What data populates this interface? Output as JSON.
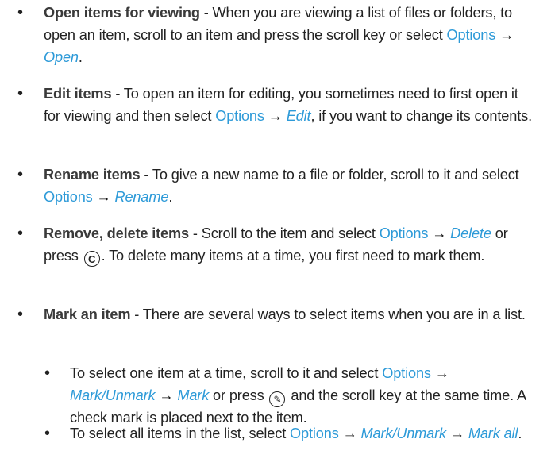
{
  "items": [
    {
      "term": "Open items for viewing",
      "text1": " - When you are viewing a list of files or folders, to open an item, scroll to an item and press the scroll key or select ",
      "menu": "Options",
      "arrow": " → ",
      "opt": "Open",
      "end": "."
    },
    {
      "term": "Edit items",
      "text1": " - To open an item for editing, you sometimes need to first open it for viewing and then select ",
      "menu": "Options",
      "arrow": " → ",
      "opt": "Edit",
      "end": ", if you want to change its contents."
    },
    {
      "term": "Rename items",
      "text1": " - To give a new name to a file or folder, scroll to it and select ",
      "menu": "Options",
      "arrow": " → ",
      "opt": "Rename",
      "end": "."
    },
    {
      "term": "Remove, delete items",
      "text1": " - Scroll to the item and select ",
      "menu": "Options",
      "arrow": " → ",
      "opt": "Delete",
      "text2": " or press ",
      "key": "C",
      "end": ". To delete many items at a time, you first need to mark them."
    },
    {
      "term": "Mark an item",
      "text1": " - There are several ways to select items when you are in a list."
    }
  ],
  "subitems": [
    {
      "text1": "To select one item at a time, scroll to it and select ",
      "menu": "Options",
      "arrow1": " → ",
      "opt1": "Mark/Unmark",
      "arrow2": " → ",
      "opt2": "Mark",
      "text2": " or press ",
      "key": "✎",
      "end": " and the scroll key at the same time. A check mark is placed next to the item."
    },
    {
      "text1": "To select all items in the list, select ",
      "menu": "Options",
      "arrow1": " → ",
      "opt1": "Mark/Unmark",
      "arrow2": " → ",
      "opt2": "Mark all",
      "end": "."
    }
  ],
  "bullet": "•"
}
